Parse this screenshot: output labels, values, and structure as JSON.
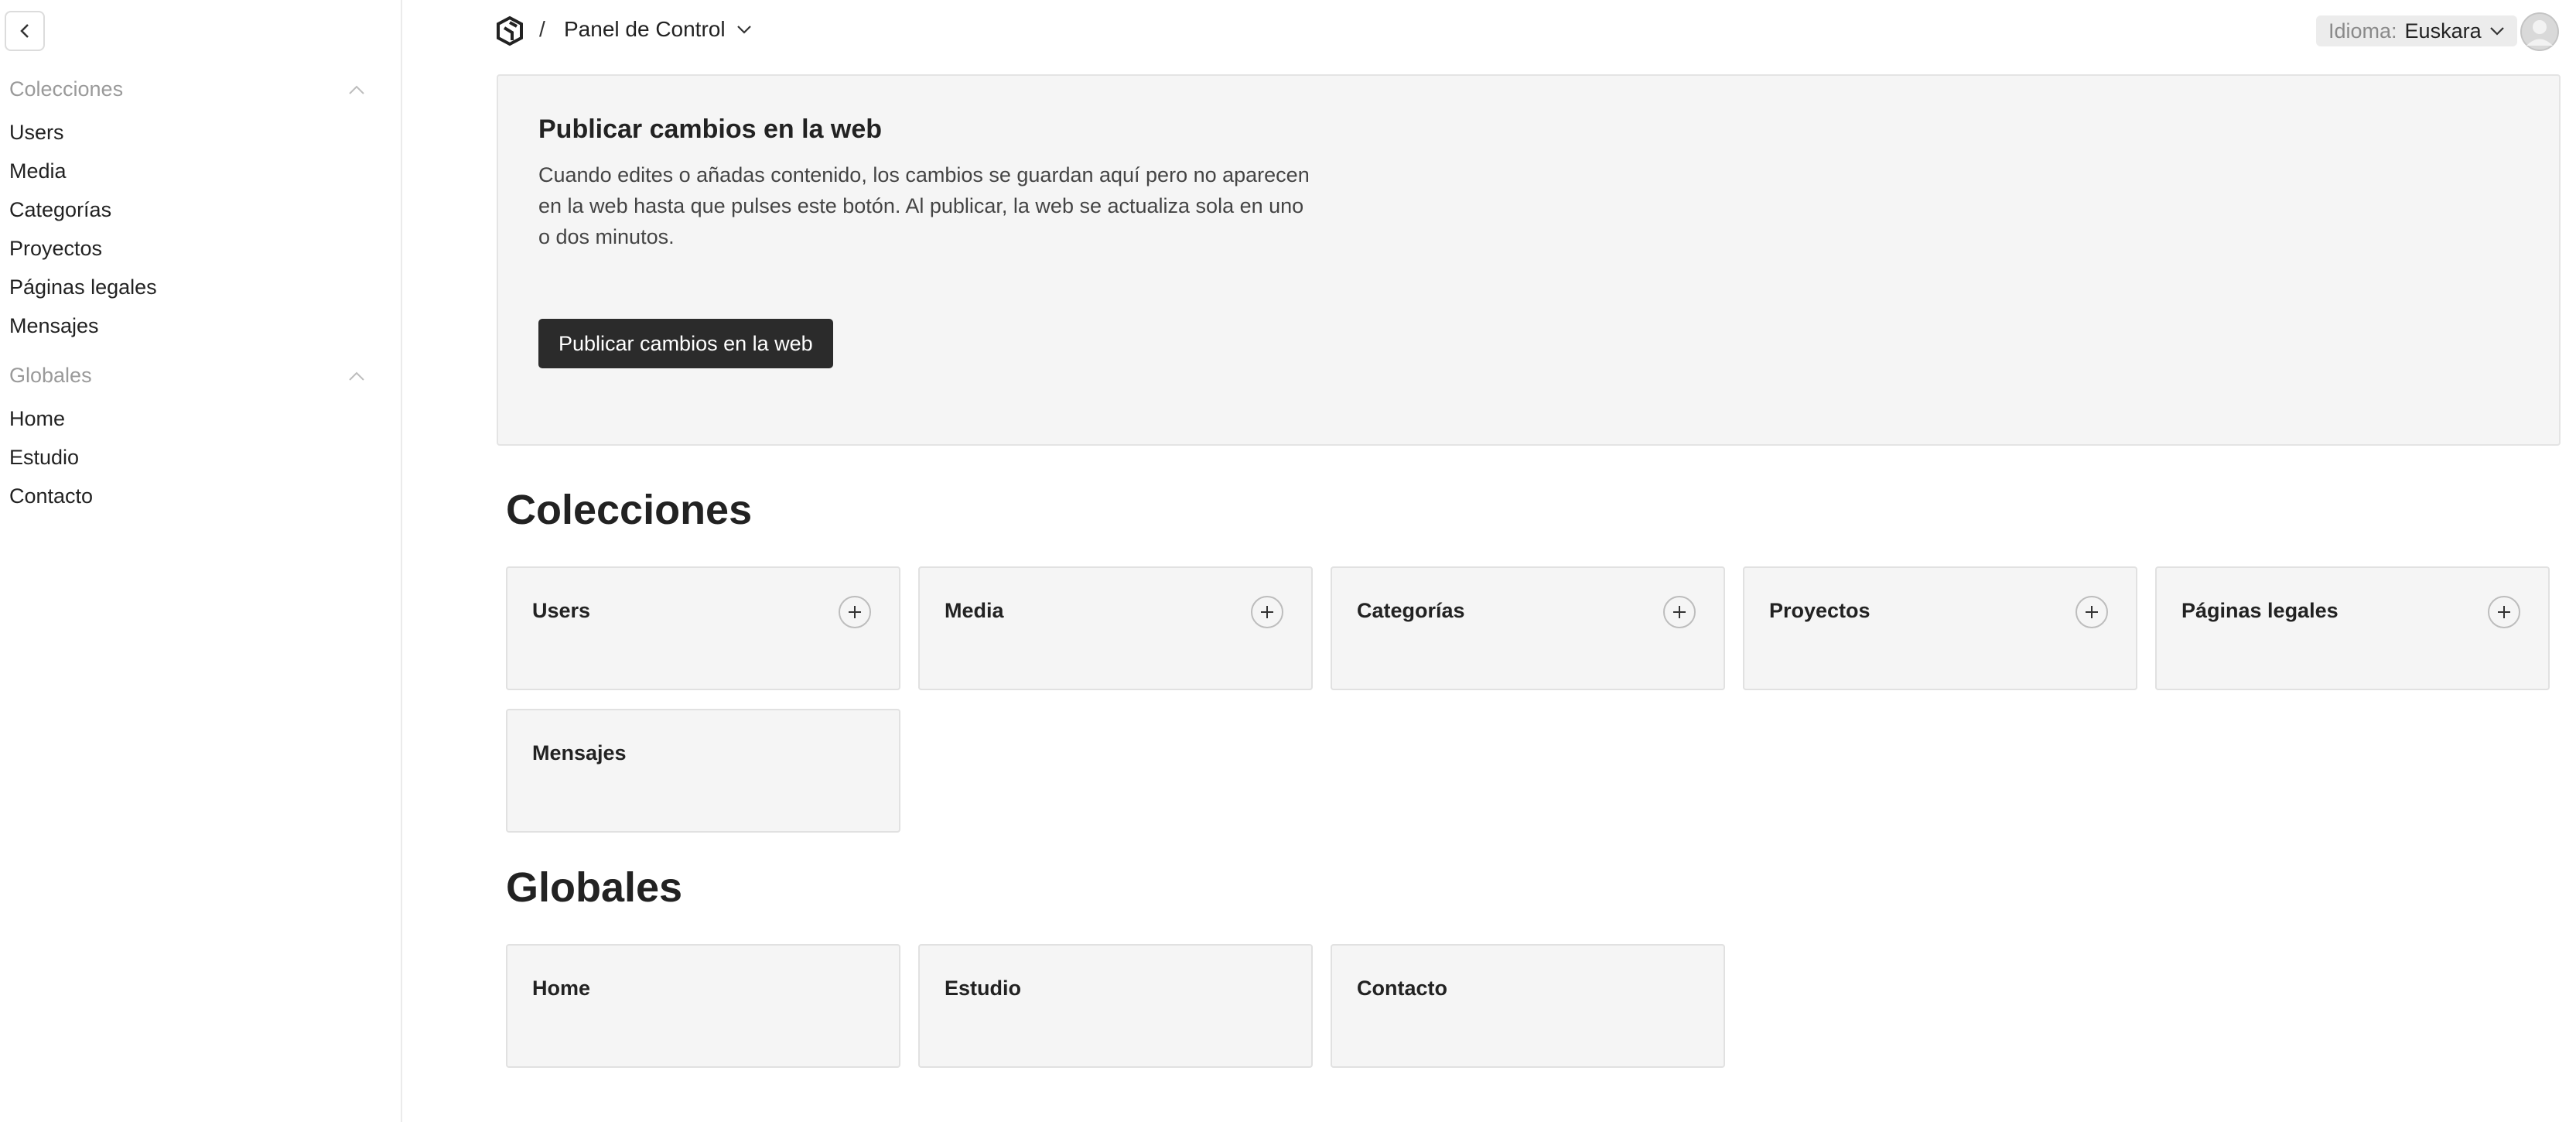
{
  "sidebar": {
    "groups": [
      {
        "label": "Colecciones",
        "items": [
          "Users",
          "Media",
          "Categorías",
          "Proyectos",
          "Páginas legales",
          "Mensajes"
        ]
      },
      {
        "label": "Globales",
        "items": [
          "Home",
          "Estudio",
          "Contacto"
        ]
      }
    ]
  },
  "header": {
    "separator": "/",
    "breadcrumb": "Panel de Control",
    "language_label": "Idioma:",
    "language_value": "Euskara"
  },
  "publish": {
    "title": "Publicar cambios en la web",
    "description": "Cuando edites o añadas contenido, los cambios se guardan aquí pero no aparecen en la web hasta que pulses este botón. Al publicar, la web se actualiza sola en uno o dos minutos.",
    "button_label": "Publicar cambios en la web"
  },
  "collections": {
    "title": "Colecciones",
    "cards": [
      "Users",
      "Media",
      "Categorías",
      "Proyectos",
      "Páginas legales",
      "Mensajes"
    ]
  },
  "globals": {
    "title": "Globales",
    "cards": [
      "Home",
      "Estudio",
      "Contacto"
    ]
  }
}
